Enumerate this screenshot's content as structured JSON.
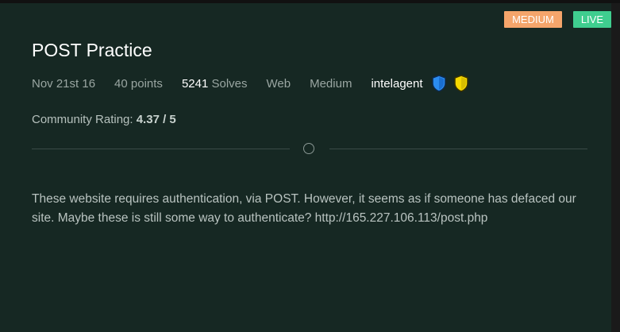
{
  "badges": {
    "difficulty": "MEDIUM",
    "status": "LIVE"
  },
  "challenge": {
    "title": "POST Practice",
    "date": "Nov 21st 16",
    "points": "40 points",
    "solves_count": "5241",
    "solves_label": "Solves",
    "category": "Web",
    "difficulty": "Medium",
    "author": "intelagent"
  },
  "rating": {
    "label": "Community Rating:",
    "value": "4.37 / 5"
  },
  "description": "These website requires authentication, via POST. However, it seems as if someone has defaced our site. Maybe these is still some way to authenticate? http://165.227.106.113/post.php",
  "colors": {
    "background": "#162823",
    "badge_medium": "#f5a56b",
    "badge_live": "#3fce8f",
    "shield_blue": "#2b8cf0",
    "shield_yellow": "#f5d800"
  },
  "icons": [
    "blue-shield-icon",
    "yellow-shield-icon",
    "divider-circle-icon"
  ]
}
